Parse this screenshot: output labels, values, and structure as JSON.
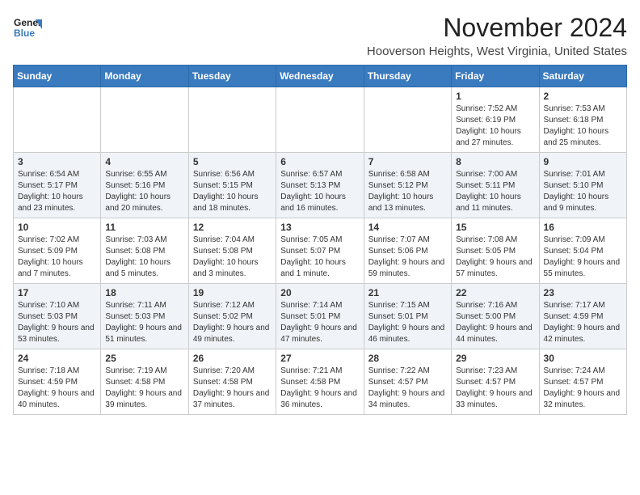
{
  "header": {
    "logo_line1": "General",
    "logo_line2": "Blue",
    "month": "November 2024",
    "location": "Hooverson Heights, West Virginia, United States"
  },
  "days_of_week": [
    "Sunday",
    "Monday",
    "Tuesday",
    "Wednesday",
    "Thursday",
    "Friday",
    "Saturday"
  ],
  "weeks": [
    [
      {
        "day": "",
        "info": ""
      },
      {
        "day": "",
        "info": ""
      },
      {
        "day": "",
        "info": ""
      },
      {
        "day": "",
        "info": ""
      },
      {
        "day": "",
        "info": ""
      },
      {
        "day": "1",
        "info": "Sunrise: 7:52 AM\nSunset: 6:19 PM\nDaylight: 10 hours and 27 minutes."
      },
      {
        "day": "2",
        "info": "Sunrise: 7:53 AM\nSunset: 6:18 PM\nDaylight: 10 hours and 25 minutes."
      }
    ],
    [
      {
        "day": "3",
        "info": "Sunrise: 6:54 AM\nSunset: 5:17 PM\nDaylight: 10 hours and 23 minutes."
      },
      {
        "day": "4",
        "info": "Sunrise: 6:55 AM\nSunset: 5:16 PM\nDaylight: 10 hours and 20 minutes."
      },
      {
        "day": "5",
        "info": "Sunrise: 6:56 AM\nSunset: 5:15 PM\nDaylight: 10 hours and 18 minutes."
      },
      {
        "day": "6",
        "info": "Sunrise: 6:57 AM\nSunset: 5:13 PM\nDaylight: 10 hours and 16 minutes."
      },
      {
        "day": "7",
        "info": "Sunrise: 6:58 AM\nSunset: 5:12 PM\nDaylight: 10 hours and 13 minutes."
      },
      {
        "day": "8",
        "info": "Sunrise: 7:00 AM\nSunset: 5:11 PM\nDaylight: 10 hours and 11 minutes."
      },
      {
        "day": "9",
        "info": "Sunrise: 7:01 AM\nSunset: 5:10 PM\nDaylight: 10 hours and 9 minutes."
      }
    ],
    [
      {
        "day": "10",
        "info": "Sunrise: 7:02 AM\nSunset: 5:09 PM\nDaylight: 10 hours and 7 minutes."
      },
      {
        "day": "11",
        "info": "Sunrise: 7:03 AM\nSunset: 5:08 PM\nDaylight: 10 hours and 5 minutes."
      },
      {
        "day": "12",
        "info": "Sunrise: 7:04 AM\nSunset: 5:08 PM\nDaylight: 10 hours and 3 minutes."
      },
      {
        "day": "13",
        "info": "Sunrise: 7:05 AM\nSunset: 5:07 PM\nDaylight: 10 hours and 1 minute."
      },
      {
        "day": "14",
        "info": "Sunrise: 7:07 AM\nSunset: 5:06 PM\nDaylight: 9 hours and 59 minutes."
      },
      {
        "day": "15",
        "info": "Sunrise: 7:08 AM\nSunset: 5:05 PM\nDaylight: 9 hours and 57 minutes."
      },
      {
        "day": "16",
        "info": "Sunrise: 7:09 AM\nSunset: 5:04 PM\nDaylight: 9 hours and 55 minutes."
      }
    ],
    [
      {
        "day": "17",
        "info": "Sunrise: 7:10 AM\nSunset: 5:03 PM\nDaylight: 9 hours and 53 minutes."
      },
      {
        "day": "18",
        "info": "Sunrise: 7:11 AM\nSunset: 5:03 PM\nDaylight: 9 hours and 51 minutes."
      },
      {
        "day": "19",
        "info": "Sunrise: 7:12 AM\nSunset: 5:02 PM\nDaylight: 9 hours and 49 minutes."
      },
      {
        "day": "20",
        "info": "Sunrise: 7:14 AM\nSunset: 5:01 PM\nDaylight: 9 hours and 47 minutes."
      },
      {
        "day": "21",
        "info": "Sunrise: 7:15 AM\nSunset: 5:01 PM\nDaylight: 9 hours and 46 minutes."
      },
      {
        "day": "22",
        "info": "Sunrise: 7:16 AM\nSunset: 5:00 PM\nDaylight: 9 hours and 44 minutes."
      },
      {
        "day": "23",
        "info": "Sunrise: 7:17 AM\nSunset: 4:59 PM\nDaylight: 9 hours and 42 minutes."
      }
    ],
    [
      {
        "day": "24",
        "info": "Sunrise: 7:18 AM\nSunset: 4:59 PM\nDaylight: 9 hours and 40 minutes."
      },
      {
        "day": "25",
        "info": "Sunrise: 7:19 AM\nSunset: 4:58 PM\nDaylight: 9 hours and 39 minutes."
      },
      {
        "day": "26",
        "info": "Sunrise: 7:20 AM\nSunset: 4:58 PM\nDaylight: 9 hours and 37 minutes."
      },
      {
        "day": "27",
        "info": "Sunrise: 7:21 AM\nSunset: 4:58 PM\nDaylight: 9 hours and 36 minutes."
      },
      {
        "day": "28",
        "info": "Sunrise: 7:22 AM\nSunset: 4:57 PM\nDaylight: 9 hours and 34 minutes."
      },
      {
        "day": "29",
        "info": "Sunrise: 7:23 AM\nSunset: 4:57 PM\nDaylight: 9 hours and 33 minutes."
      },
      {
        "day": "30",
        "info": "Sunrise: 7:24 AM\nSunset: 4:57 PM\nDaylight: 9 hours and 32 minutes."
      }
    ]
  ]
}
